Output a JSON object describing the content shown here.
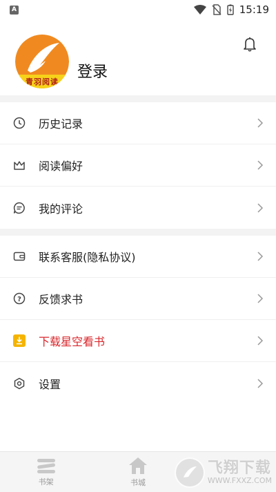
{
  "status_bar": {
    "notification_icon": "A",
    "time": "15:19"
  },
  "header": {
    "login_label": "登录",
    "avatar_logo_text": "青羽阅读"
  },
  "menu_group_1": [
    {
      "label": "历史记录",
      "icon": "clock-icon"
    },
    {
      "label": "阅读偏好",
      "icon": "crown-icon"
    },
    {
      "label": "我的评论",
      "icon": "comment-icon"
    }
  ],
  "menu_group_2": [
    {
      "label": "联系客服(隐私协议)",
      "icon": "wallet-icon"
    },
    {
      "label": "反馈求书",
      "icon": "help-icon"
    },
    {
      "label": "下载星空看书",
      "icon": "download-icon",
      "color": "#d9262b"
    },
    {
      "label": "设置",
      "icon": "gear-icon"
    }
  ],
  "bottom_nav": {
    "tabs": [
      {
        "label": "书架"
      },
      {
        "label": "书城"
      }
    ]
  },
  "watermark": {
    "title": "飞翔下载",
    "url": "WWW.FXXZ.COM"
  },
  "colors": {
    "accent_orange": "#f08a20",
    "download_yellow": "#f5b400",
    "red_text": "#d9262b"
  }
}
